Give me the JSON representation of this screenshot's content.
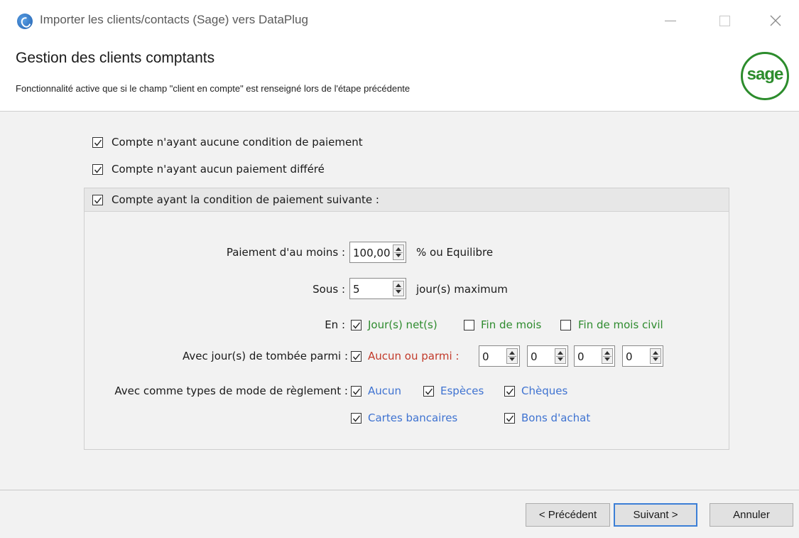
{
  "window": {
    "title": "Importer les clients/contacts (Sage) vers DataPlug",
    "minimize_icon": "minimize-icon",
    "maximize_icon": "maximize-icon",
    "close_icon": "close-icon"
  },
  "header": {
    "title": "Gestion des clients comptants",
    "subtitle": "Fonctionnalité active que si le champ \"client en compte\" est renseigné lors de l'étape précédente",
    "logo_text": "sage",
    "logo_color": "#2c8c2c"
  },
  "options": [
    {
      "label": "Compte n'ayant aucune condition de paiement",
      "checked": true
    },
    {
      "label": "Compte n'ayant aucun paiement différé",
      "checked": true
    }
  ],
  "group": {
    "label": "Compte ayant la condition de paiement suivante :",
    "checked": true,
    "payment": {
      "label": "Paiement d'au moins  :",
      "value": "100,00",
      "suffix": "% ou Equilibre"
    },
    "delay": {
      "label": "Sous :",
      "value": "5",
      "suffix": "jour(s) maximum"
    },
    "mode": {
      "label": "En :",
      "options": [
        {
          "label": "Jour(s) net(s)",
          "checked": true
        },
        {
          "label": "Fin de mois",
          "checked": false
        },
        {
          "label": "Fin de mois civil",
          "checked": false
        }
      ]
    },
    "due_days": {
      "label": "Avec jour(s) de tombée parmi :",
      "option": {
        "label": "Aucun ou parmi :",
        "checked": true
      },
      "values": [
        "0",
        "0",
        "0",
        "0"
      ]
    },
    "payment_types": {
      "label": "Avec comme types de mode de règlement :",
      "options": [
        {
          "label": "Aucun",
          "checked": true
        },
        {
          "label": "Espèces",
          "checked": true
        },
        {
          "label": "Chèques",
          "checked": true
        },
        {
          "label": "Cartes bancaires",
          "checked": true
        },
        {
          "label": "Bons d'achat",
          "checked": true
        }
      ]
    }
  },
  "footer": {
    "prev_label": "< Précédent",
    "next_label": "Suivant >",
    "cancel_label": "Annuler"
  },
  "colors": {
    "green": "#2e8b2e",
    "red": "#c23a2a",
    "blue": "#3f73d1",
    "panel_bg": "#f2f2f2"
  }
}
